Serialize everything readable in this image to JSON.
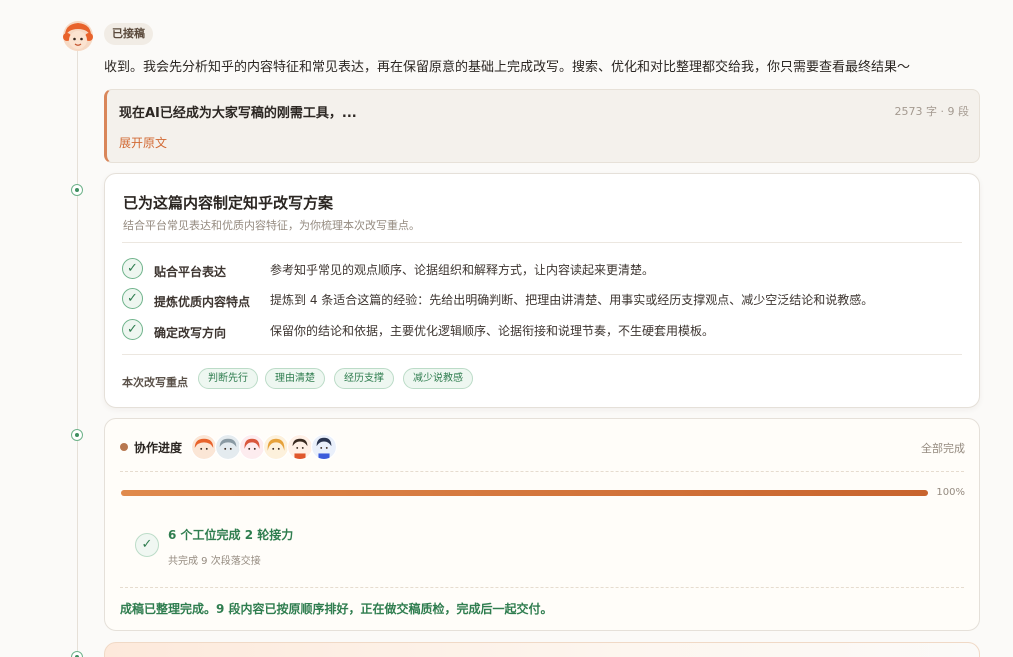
{
  "header": {
    "badge": "已接稿",
    "intro": "收到。我会先分析知乎的内容特征和常见表达，再在保留原意的基础上完成改写。搜索、优化和对比整理都交给我，你只需要查看最终结果～"
  },
  "source": {
    "title": "现在AI已经成为大家写稿的刚需工具，...",
    "meta": "2573 字 · 9 段",
    "expand_label": "展开原文"
  },
  "plan": {
    "title": "已为这篇内容制定知乎改写方案",
    "subtitle": "结合平台常见表达和优质内容特征，为你梳理本次改写重点。",
    "steps": [
      {
        "name": "贴合平台表达",
        "desc": "参考知乎常见的观点顺序、论据组织和解释方式，让内容读起来更清楚。"
      },
      {
        "name": "提炼优质内容特点",
        "desc": "提炼到 4 条适合这篇的经验：先给出明确判断、把理由讲清楚、用事实或经历支撑观点、减少空泛结论和说教感。"
      },
      {
        "name": "确定改写方向",
        "desc": "保留你的结论和依据，主要优化逻辑顺序、论据衔接和说理节奏，不生硬套用模板。"
      }
    ],
    "check_glyph": "✓",
    "focus_label": "本次改写重点",
    "tags": [
      "判断先行",
      "理由清楚",
      "经历支撑",
      "减少说教感"
    ]
  },
  "progress": {
    "label": "协作进度",
    "status": "全部完成",
    "percent_value": 100,
    "percent_label": "100%",
    "done_glyph": "✓",
    "done_title": "6 个工位完成 2 轮接力",
    "done_sub": "共完成 9 次段落交接",
    "final_text": "成稿已整理完成。9 段内容已按原顺序排好，正在做交稿质检，完成后一起交付。"
  },
  "colors": {
    "accent": "#d26a34",
    "success": "#2f7d4f",
    "bar_start": "#e08a4d",
    "bar_end": "#c8642e"
  }
}
